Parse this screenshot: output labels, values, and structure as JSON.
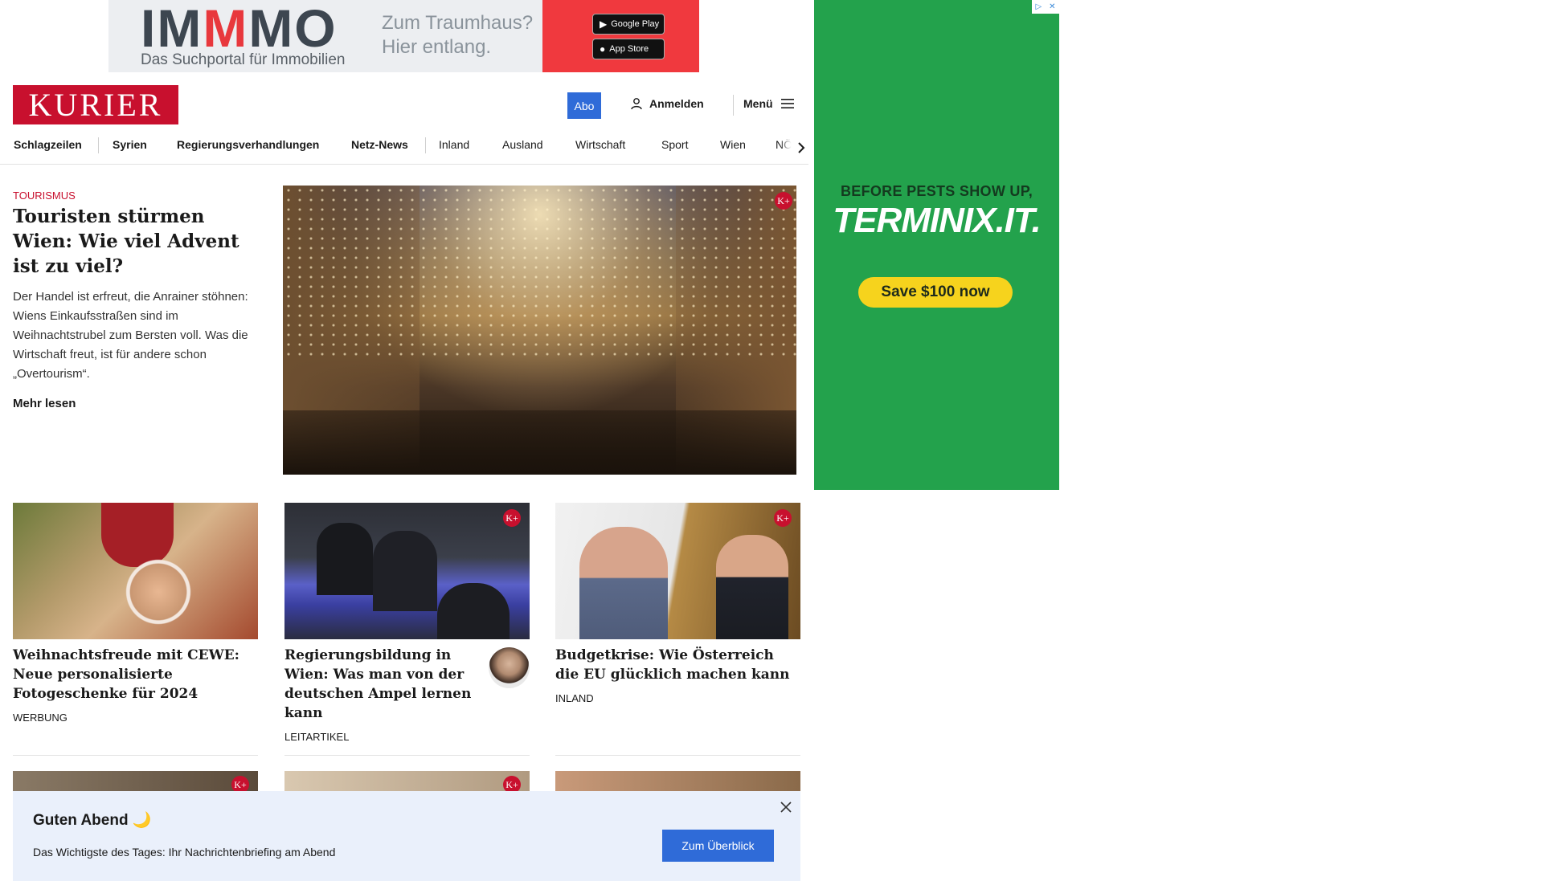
{
  "top_ad": {
    "brand_part1": "IM",
    "brand_part2": "M",
    "brand_part3": "MO",
    "tagline": "Das Suchportal für Immobilien",
    "slogan_line1": "Zum Traumhaus?",
    "slogan_line2": "Hier entlang.",
    "google_play": "Google Play",
    "app_store": "App Store"
  },
  "header": {
    "logo": "KURIER",
    "abo": "Abo",
    "login": "Anmelden",
    "menu": "Menü"
  },
  "nav": {
    "items": [
      "Schlagzeilen",
      "Syrien",
      "Regierungsverhandlungen",
      "Netz-News",
      "Inland",
      "Ausland",
      "Wirtschaft",
      "Sport",
      "Wien",
      "NÖ"
    ]
  },
  "lead": {
    "kicker": "TOURISMUS",
    "title": "Touristen stürmen Wien: Wie viel Advent ist zu viel?",
    "text": "Der Handel ist erfreut, die Anrainer stöhnen: Wiens Einkaufsstraßen sind im Weihnachtstrubel zum Bersten voll. Was die Wirtschaft freut, ist für andere schon „Overtourism“.",
    "more": "Mehr lesen",
    "badge": "K+"
  },
  "cards": [
    {
      "title": "Weihnachtsfreude mit CEWE: Neue personalisierte Fotogeschenke für 2024",
      "tag": "WERBUNG"
    },
    {
      "title": "Regierungsbildung in Wien: Was man von der deutschen Ampel lernen kann",
      "tag": "LEITARTIKEL",
      "badge": "K+"
    },
    {
      "title": "Budgetkrise: Wie Österreich die EU glücklich machen kann",
      "tag": "INLAND",
      "badge": "K+"
    }
  ],
  "notice": {
    "title": "Guten Abend 🌙",
    "text": "Das Wichtigste des Tages: Ihr Nachrichtenbriefing am Abend",
    "button": "Zum Überblick"
  },
  "side_ad": {
    "line1": "BEFORE PESTS SHOW UP,",
    "brand": "TERMINIX.IT.",
    "cta": "Save $100 now"
  },
  "colors": {
    "brand_red": "#c8102e",
    "accent_blue": "#2f6bd8",
    "ad_green": "#23a24c"
  }
}
